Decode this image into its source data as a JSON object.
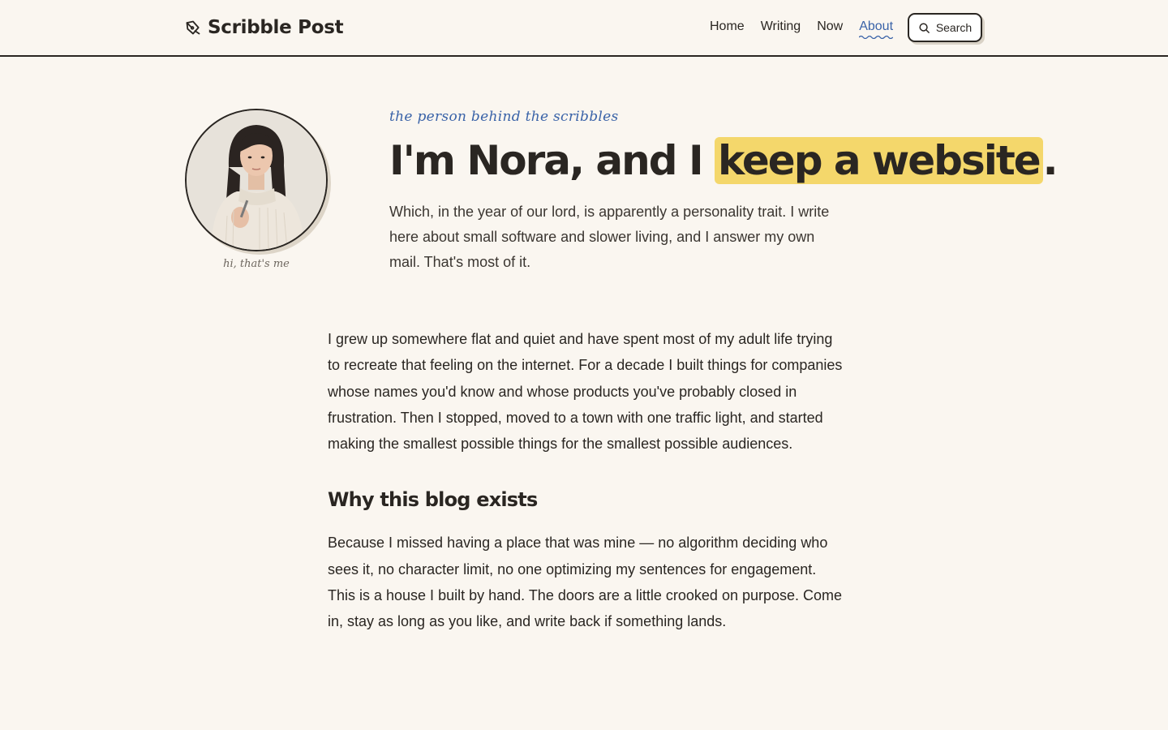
{
  "header": {
    "logo_text": "Scribble Post",
    "logo_icon": "pen-nib-icon",
    "nav": [
      {
        "label": "Home",
        "active": false
      },
      {
        "label": "Writing",
        "active": false
      },
      {
        "label": "Now",
        "active": false
      },
      {
        "label": "About",
        "active": true
      }
    ],
    "search_label": "Search",
    "search_icon": "search-icon"
  },
  "hero": {
    "avatar_caption": "hi, that's me",
    "eyebrow": "the person behind the scribbles",
    "title_before": "I'm Nora, and I ",
    "title_highlight": "keep a website",
    "title_after": ".",
    "lede": "Which, in the year of our lord, is apparently a personality trait. I write here about small software and slower living, and I answer my own mail. That's most of it."
  },
  "article": {
    "intro": "I grew up somewhere flat and quiet and have spent most of my adult life trying to recreate that feeling on the internet. For a decade I built things for companies whose names you'd know and whose products you've probably closed in frustration. Then I stopped, moved to a town with one traffic light, and started making the smallest possible things for the smallest possible audiences.",
    "section_heading": "Why this blog exists",
    "section_body": "Because I missed having a place that was mine — no algorithm deciding who sees it, no character limit, no one optimizing my sentences for engagement. This is a house I built by hand. The doors are a little crooked on purpose. Come in, stay as long as you like, and write back if something lands."
  },
  "colors": {
    "background": "#faf6f0",
    "ink": "#2a2622",
    "accent_blue": "#3a63a8",
    "highlight_yellow": "#f4d76b"
  }
}
